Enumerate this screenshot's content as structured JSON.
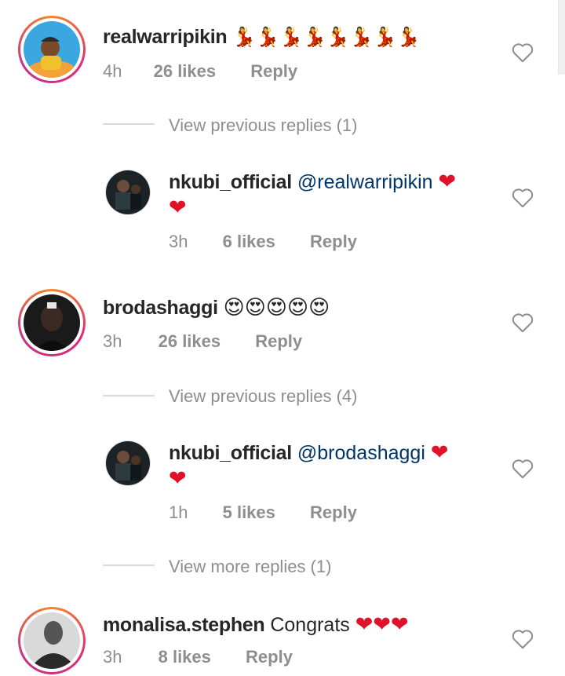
{
  "comments": [
    {
      "username": "realwarripikin",
      "text": "💃💃💃💃💃💃💃💃",
      "time": "4h",
      "likes": "26 likes",
      "reply_label": "Reply"
    },
    {
      "username": "nkubi_official",
      "mention": "@realwarripikin",
      "text_line1": "❤",
      "text_line2": "❤",
      "time": "3h",
      "likes": "6 likes",
      "reply_label": "Reply"
    },
    {
      "username": "brodashaggi",
      "text": "😍😍😍😍😍",
      "time": "3h",
      "likes": "26 likes",
      "reply_label": "Reply"
    },
    {
      "username": "nkubi_official",
      "mention": "@brodashaggi",
      "text_line1": "❤",
      "text_line2": "❤",
      "time": "1h",
      "likes": "5 likes",
      "reply_label": "Reply"
    },
    {
      "username": "monalisa.stephen",
      "text": "Congrats",
      "hearts": "❤❤❤",
      "time": "3h",
      "likes": "8 likes",
      "reply_label": "Reply"
    }
  ],
  "view_replies": [
    "View previous replies (1)",
    "View previous replies (4)",
    "View more replies (1)"
  ],
  "colors": {
    "mention": "#003569",
    "meta": "#8e8e8e",
    "heart": "#e0122a",
    "ring_start": "#f58529",
    "ring_end": "#dd2a7b"
  },
  "icons": {
    "like": "heart-outline-icon"
  }
}
